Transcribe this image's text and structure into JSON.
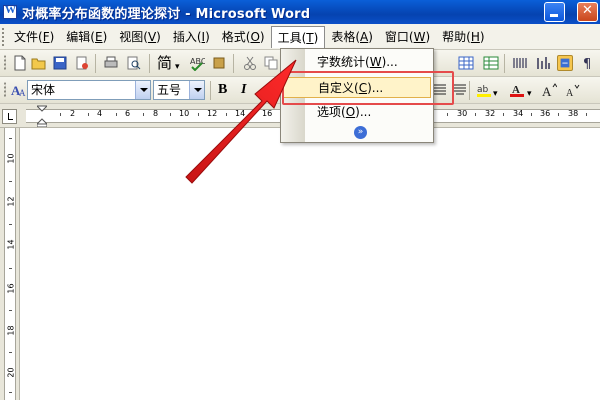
{
  "window": {
    "title": "对概率分布函数的理论探讨 - Microsoft Word"
  },
  "menubar": {
    "items": [
      {
        "label": "文件(",
        "key": "F",
        "close": ")"
      },
      {
        "label": "编辑(",
        "key": "E",
        "close": ")"
      },
      {
        "label": "视图(",
        "key": "V",
        "close": ")"
      },
      {
        "label": "插入(",
        "key": "I",
        "close": ")"
      },
      {
        "label": "格式(",
        "key": "O",
        "close": ")"
      },
      {
        "label": "工具(",
        "key": "T",
        "close": ")"
      },
      {
        "label": "表格(",
        "key": "A",
        "close": ")"
      },
      {
        "label": "窗口(",
        "key": "W",
        "close": ")"
      },
      {
        "label": "帮助(",
        "key": "H",
        "close": ")"
      }
    ]
  },
  "toolbar": {
    "chinese_conv_label": "简",
    "font_name": "宋体",
    "font_size": "五号",
    "bold_label": "B",
    "italic_label": "I"
  },
  "ruler": {
    "h_numbers": [
      "2",
      "4",
      "6",
      "8",
      "10",
      "12",
      "14",
      "16",
      "30",
      "32",
      "34",
      "36",
      "38"
    ],
    "v_numbers": [
      "10",
      "12",
      "14",
      "16",
      "18",
      "20"
    ]
  },
  "tools_menu": {
    "items": [
      {
        "label": "字数统计(",
        "key": "W",
        "close": ")..."
      },
      {
        "label": "自定义(",
        "key": "C",
        "close": ")..."
      },
      {
        "label": "选项(",
        "key": "O",
        "close": ")..."
      }
    ],
    "expand_icon": "double-chevron-down-icon"
  },
  "colors": {
    "titlebar": "#0543b0",
    "highlight_box": "#e54b4b",
    "annotation_arrow": "#e02020",
    "menu_hover": "#fff3c9"
  }
}
